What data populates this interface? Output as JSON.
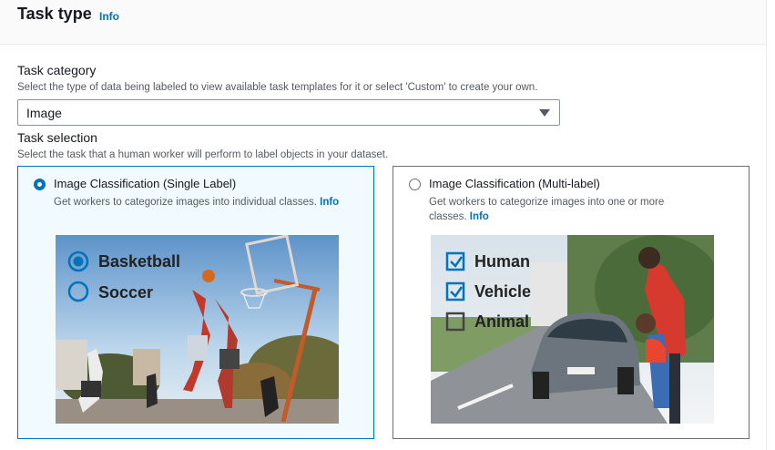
{
  "header": {
    "title": "Task type",
    "info": "Info"
  },
  "task_category": {
    "label": "Task category",
    "description": "Select the type of data being labeled to view available task templates for it or select 'Custom' to create your own.",
    "selected": "Image"
  },
  "task_selection": {
    "label": "Task selection",
    "description": "Select the task that a human worker will perform to label objects in your dataset.",
    "cards": [
      {
        "title": "Image Classification (Single Label)",
        "description": "Get workers to categorize images into individual classes.",
        "info": "Info",
        "selected": true,
        "image_labels": [
          "Basketball",
          "Soccer"
        ]
      },
      {
        "title": "Image Classification (Multi-label)",
        "description": "Get workers to categorize images into one or more classes.",
        "info": "Info",
        "selected": false,
        "image_labels": [
          "Human",
          "Vehicle",
          "Animal"
        ]
      }
    ]
  },
  "colors": {
    "accent": "#0073bb",
    "selected_bg": "#f1faff"
  }
}
